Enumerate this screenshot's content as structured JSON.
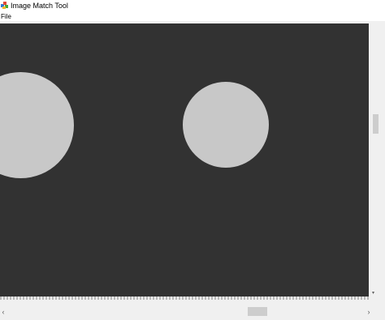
{
  "window": {
    "title": "Image Match Tool",
    "app_icon": "app-icon"
  },
  "menubar": {
    "items": [
      {
        "label": "File"
      }
    ]
  },
  "canvas": {
    "background_color": "#323232",
    "shape_color": "#c8c8c8",
    "shapes": [
      "circle",
      "circle"
    ]
  },
  "scrollbars": {
    "horizontal": {
      "left_arrow": "‹",
      "right_arrow": "›"
    },
    "vertical": {
      "down_arrow": "▾"
    }
  }
}
